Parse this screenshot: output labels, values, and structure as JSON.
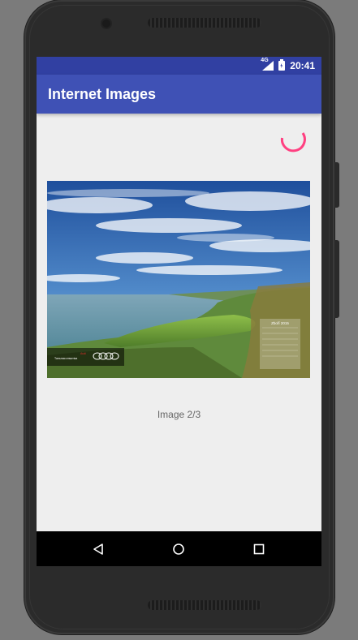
{
  "status_bar": {
    "network": "4G",
    "time": "20:41",
    "icons": [
      "signal-icon",
      "battery-charging-icon"
    ]
  },
  "app_bar": {
    "title": "Internet Images"
  },
  "loading": {
    "icon": "loading-spinner-icon",
    "color": "#ff4081"
  },
  "image": {
    "overlay_brand": "Audi",
    "overlay_text": "Тальная атмотіка",
    "calendar_title": "Zboří 2015"
  },
  "caption": "Image 2/3",
  "nav_bar": {
    "icons": [
      "back-icon",
      "home-icon",
      "recents-icon"
    ]
  },
  "colors": {
    "primary": "#3f51b5",
    "primary_dark": "#3140a2",
    "accent": "#ff4081",
    "background": "#eeeeee"
  }
}
